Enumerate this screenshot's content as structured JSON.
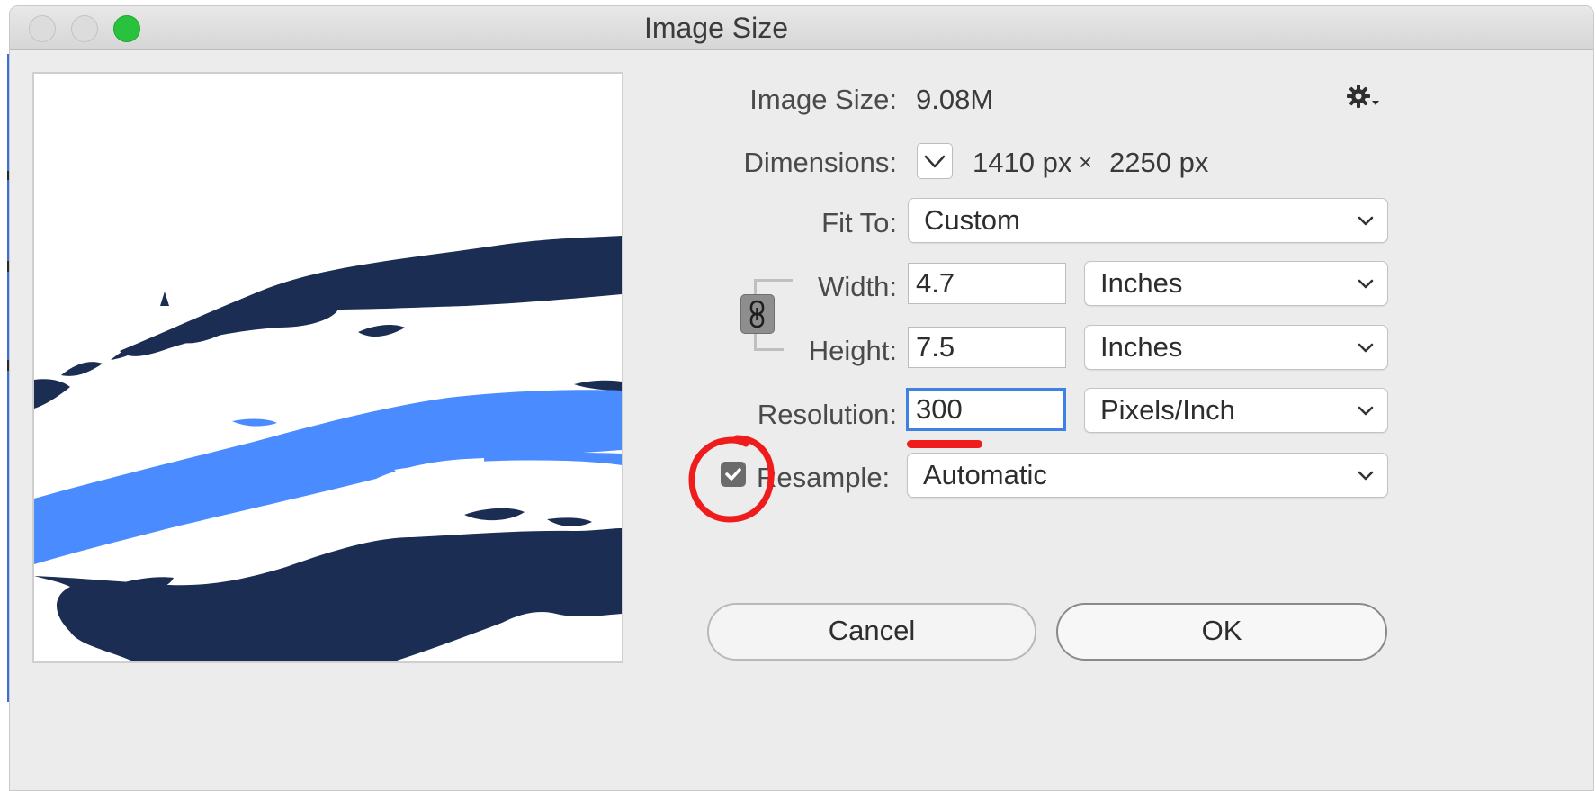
{
  "window": {
    "title": "Image Size"
  },
  "info": {
    "image_size_label": "Image Size:",
    "image_size_value": "9.08M",
    "dimensions_label": "Dimensions:",
    "dimensions_width": "1410 px",
    "dimensions_sep": "×",
    "dimensions_height": "2250 px"
  },
  "fit_to": {
    "label": "Fit To:",
    "value": "Custom"
  },
  "width": {
    "label": "Width:",
    "value": "4.7",
    "unit": "Inches"
  },
  "height": {
    "label": "Height:",
    "value": "7.5",
    "unit": "Inches"
  },
  "resolution": {
    "label": "Resolution:",
    "value": "300",
    "unit": "Pixels/Inch"
  },
  "resample": {
    "label": "Resample:",
    "checked": true,
    "value": "Automatic"
  },
  "buttons": {
    "cancel": "Cancel",
    "ok": "OK"
  },
  "icons": {
    "gear": "gear-icon",
    "dimensions_toggle": "chevron-down-icon",
    "constrain": "link-icon",
    "checkbox": "checkmark-icon"
  },
  "colors": {
    "preview_navy": "#1b2d52",
    "preview_blue": "#4a8cff",
    "focus_blue": "#3f80e4",
    "annotation_red": "#ee1c1c",
    "zoom_green": "#29c23d"
  }
}
